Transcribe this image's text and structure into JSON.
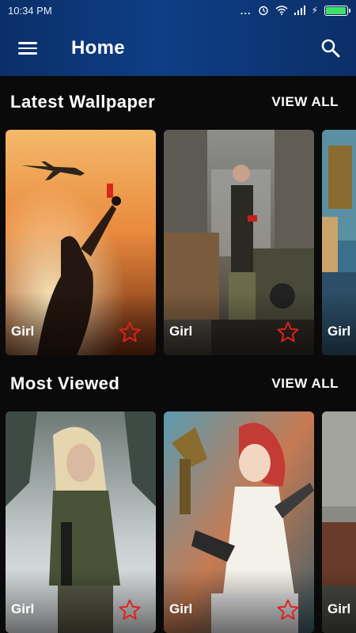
{
  "status_bar": {
    "time": "10:34 PM",
    "dots": "...",
    "bolt": "⚡"
  },
  "app_bar": {
    "title": "Home"
  },
  "sections": [
    {
      "title": "Latest Wallpaper",
      "view_all": "VIEW ALL",
      "cards": [
        {
          "label": "Girl"
        },
        {
          "label": "Girl"
        },
        {
          "label": "Girl"
        }
      ]
    },
    {
      "title": "Most Viewed",
      "view_all": "VIEW ALL",
      "cards": [
        {
          "label": "Girl"
        },
        {
          "label": "Girl"
        },
        {
          "label": "Girl"
        }
      ]
    }
  ],
  "colors": {
    "app_bar": "#0e3e86",
    "background": "#0a0a0a",
    "star_outline": "#e02020",
    "battery": "#3ee06a"
  },
  "icons": [
    "menu-icon",
    "search-icon",
    "star-outline-icon",
    "alarm-icon",
    "wifi-icon",
    "signal-icon",
    "battery-icon"
  ]
}
